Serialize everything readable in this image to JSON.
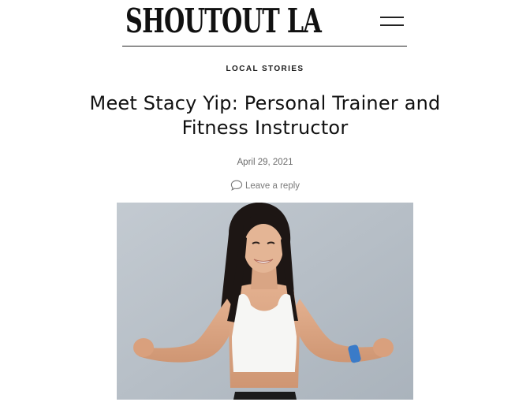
{
  "header": {
    "logo_text": "SHOUTOUT LA",
    "menu_icon": "hamburger-menu-icon"
  },
  "article": {
    "category": "LOCAL STORIES",
    "title": "Meet Stacy Yip: Personal Trainer and Fitness Instructor",
    "date": "April 29, 2021",
    "reply_label": "Leave a reply",
    "reply_icon": "comment-bubble-icon"
  },
  "colors": {
    "text": "#111111",
    "meta_text": "#6b6b6b",
    "hero_wall": "#b9c1c9"
  }
}
